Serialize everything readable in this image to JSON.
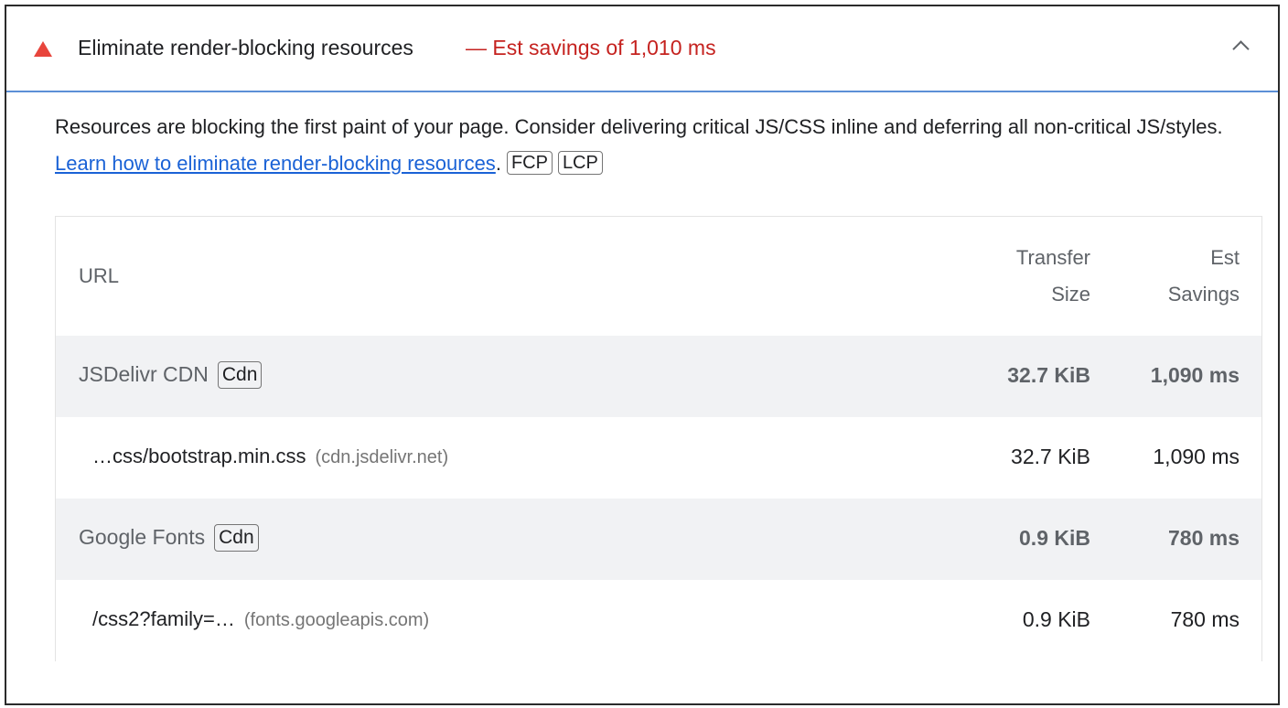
{
  "audit": {
    "title": "Eliminate render-blocking resources",
    "savings": "— Est savings of 1,010 ms",
    "icon": "warning-triangle-icon",
    "status_color": "#e8453c",
    "savings_color": "#c5221f"
  },
  "description": {
    "text": "Resources are blocking the first paint of your page. Consider delivering critical JS/CSS inline and deferring all non-critical JS/styles. ",
    "link_text": "Learn how to eliminate render-blocking resources",
    "after_link": ".",
    "chips": [
      "FCP",
      "LCP"
    ]
  },
  "table": {
    "headers": {
      "url": "URL",
      "transfer_size_line1": "Transfer",
      "transfer_size_line2": "Size",
      "est_savings_line1": "Est",
      "est_savings_line2": "Savings"
    },
    "groups": [
      {
        "name": "JSDelivr CDN",
        "chip": "Cdn",
        "transfer_size": "32.7 KiB",
        "est_savings": "1,090 ms",
        "items": [
          {
            "url": "…css/bootstrap.min.css",
            "host": "(cdn.jsdelivr.net)",
            "transfer_size": "32.7 KiB",
            "est_savings": "1,090 ms"
          }
        ]
      },
      {
        "name": "Google Fonts",
        "chip": "Cdn",
        "transfer_size": "0.9 KiB",
        "est_savings": "780 ms",
        "items": [
          {
            "url": "/css2?family=…",
            "host": "(fonts.googleapis.com)",
            "transfer_size": "0.9 KiB",
            "est_savings": "780 ms"
          }
        ]
      }
    ]
  }
}
